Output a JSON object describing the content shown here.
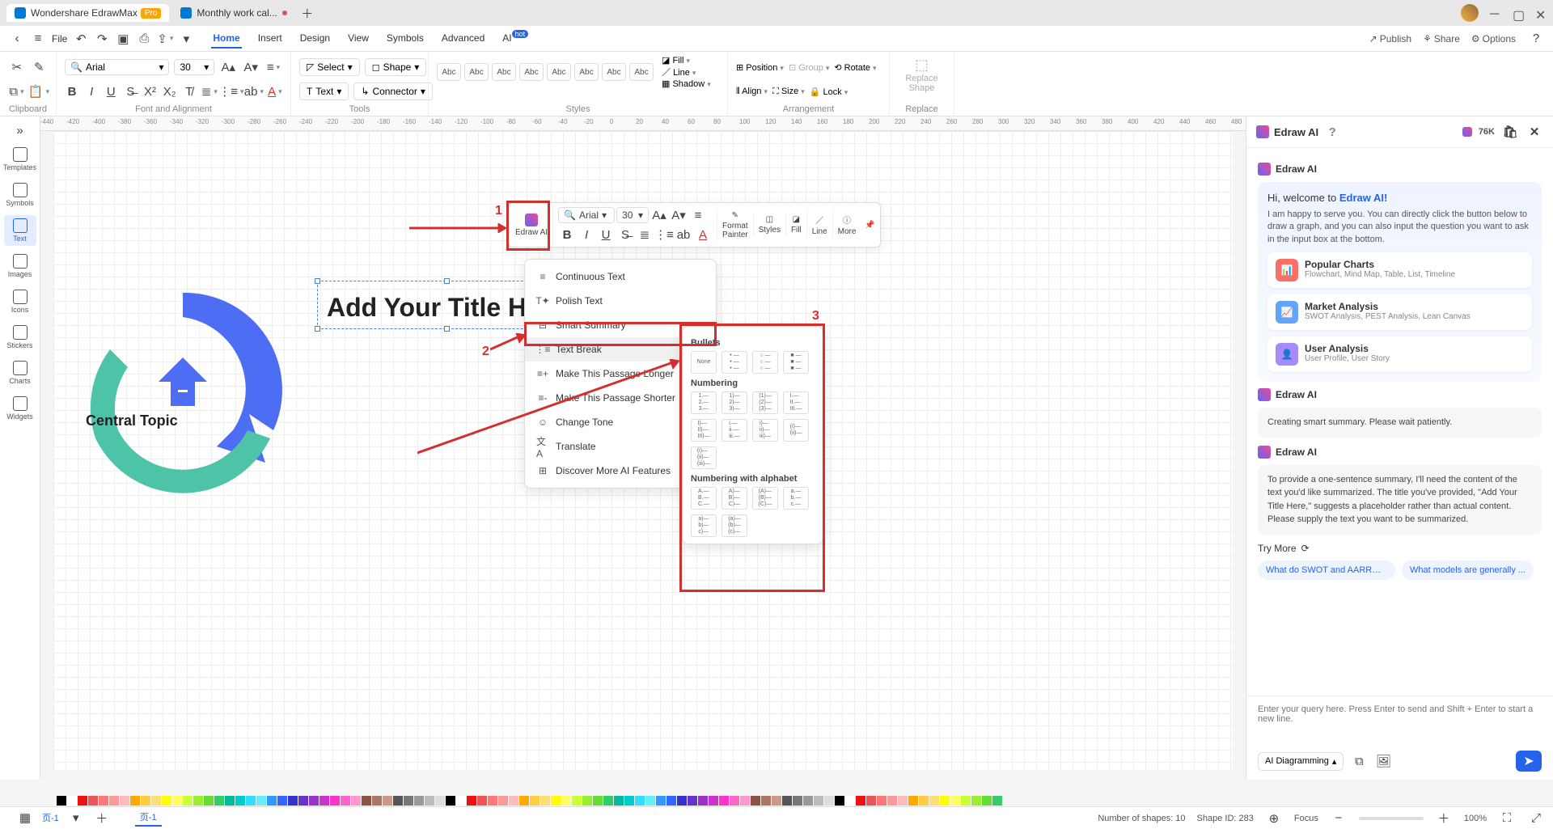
{
  "titlebar": {
    "tab1": "Wondershare EdrawMax",
    "pro": "Pro",
    "tab2": "Monthly work cal..."
  },
  "menubar": {
    "file": "File",
    "items": [
      "Home",
      "Insert",
      "Design",
      "View",
      "Symbols",
      "Advanced",
      "AI"
    ],
    "hot": "hot",
    "publish": "Publish",
    "share": "Share",
    "options": "Options"
  },
  "ribbon": {
    "font": "Arial",
    "size": "30",
    "clipboard": "Clipboard",
    "fontalign": "Font and Alignment",
    "tools": "Tools",
    "select": "Select",
    "shape": "Shape",
    "text": "Text",
    "connector": "Connector",
    "styles": "Styles",
    "abc": "Abc",
    "fill": "Fill",
    "line": "Line",
    "shadow": "Shadow",
    "arrangement": "Arrangement",
    "position": "Position",
    "align": "Align",
    "group": "Group",
    "sizeBtn": "Size",
    "rotate": "Rotate",
    "lock": "Lock",
    "replace": "Replace",
    "replaceShape": "Replace\nShape"
  },
  "leftbar": {
    "templates": "Templates",
    "symbols": "Symbols",
    "text": "Text",
    "images": "Images",
    "icons": "Icons",
    "stickers": "Stickers",
    "charts": "Charts",
    "widgets": "Widgets"
  },
  "canvas": {
    "title": "Add Your Title Here",
    "central": "Central Topic"
  },
  "float": {
    "edrawai": "Edraw AI",
    "font": "Arial",
    "size": "30",
    "format": "Format\nPainter",
    "styles": "Styles",
    "fill": "Fill",
    "line": "Line",
    "more": "More"
  },
  "aiMenu": {
    "continuous": "Continuous Text",
    "polish": "Polish Text",
    "summary": "Smart Summary",
    "textbreak": "Text Break",
    "longer": "Make This Passage Longer",
    "shorter": "Make This Passage Shorter",
    "tone": "Change Tone",
    "translate": "Translate",
    "discover": "Discover More AI Features"
  },
  "bullets": {
    "h1": "Bullets",
    "none": "None",
    "h2": "Numbering",
    "h3": "Numbering with alphabet"
  },
  "aiPanel": {
    "title": "Edraw AI",
    "tokens": "76K",
    "welcomePrefix": "Hi, welcome to ",
    "welcomeHl": "Edraw AI!",
    "welcomeBody": "I am happy to serve you. You can directly click the button below to draw a graph, and you can also input the question you want to ask in the input box at the bottom.",
    "s1t": "Popular Charts",
    "s1d": "Flowchart, Mind Map, Table, List, Timeline",
    "s2t": "Market Analysis",
    "s2d": "SWOT Analysis, PEST Analysis, Lean Canvas",
    "s3t": "User Analysis",
    "s3d": "User Profile, User Story",
    "msg1": "Creating smart summary. Please wait patiently.",
    "msg2": "To provide a one-sentence summary, I'll need the content of the text you'd like summarized. The title you've provided, \"Add Your Title Here,\" suggests a placeholder rather than actual content. Please supply the text you want to be summarized.",
    "tryMore": "Try More",
    "chip1": "What do SWOT and AARRR ...",
    "chip2": "What models are generally ...",
    "placeholder": "Enter your query here. Press Enter to send and Shift + Enter to start a new line.",
    "diag": "AI Diagramming"
  },
  "status": {
    "page": "页-1",
    "pageTab": "页-1",
    "shapes": "Number of shapes: 10",
    "shapeId": "Shape ID: 283",
    "focus": "Focus",
    "zoom": "100%"
  },
  "annot": {
    "n1": "1",
    "n2": "2",
    "n3": "3"
  }
}
